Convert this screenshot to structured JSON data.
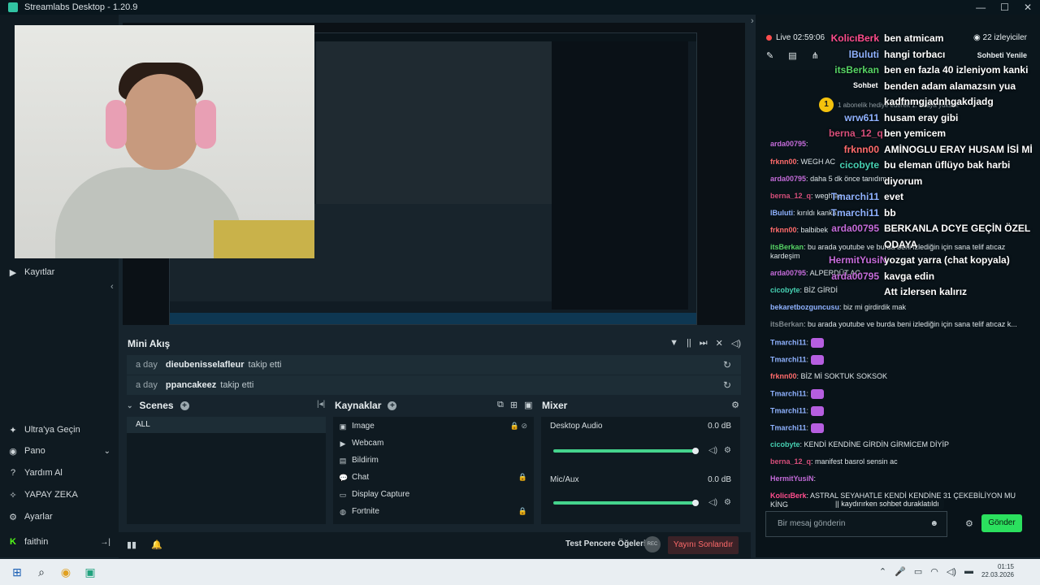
{
  "app": {
    "title": "Streamlabs Desktop - 1.20.9"
  },
  "nav": {
    "items": [
      {
        "id": "kayitlar",
        "label": "Kayıtlar",
        "icon": "play-circle-icon"
      },
      {
        "id": "ultra",
        "label": "Ultra'ya Geçin",
        "icon": "ultra-icon"
      },
      {
        "id": "pano",
        "label": "Pano",
        "icon": "dashboard-icon"
      },
      {
        "id": "yardim",
        "label": "Yardım Al",
        "icon": "help-icon"
      },
      {
        "id": "yapay",
        "label": "YAPAY ZEKA",
        "icon": "ai-spark-icon"
      },
      {
        "id": "ayarlar",
        "label": "Ayarlar",
        "icon": "gear-icon"
      },
      {
        "id": "user",
        "label": "faithin",
        "icon": "kick-icon"
      }
    ]
  },
  "mini_feed": {
    "title": "Mini Akış",
    "rows": [
      {
        "time": "a day",
        "user": "dieubenisselafleur",
        "action": "takip etti"
      },
      {
        "time": "a day",
        "user": "ppancakeez",
        "action": "takip etti"
      }
    ]
  },
  "scenes": {
    "title": "Scenes",
    "items": [
      "ALL"
    ]
  },
  "sources": {
    "title": "Kaynaklar",
    "items": [
      {
        "label": "Image",
        "icon": "image-icon",
        "locked": true
      },
      {
        "label": "Webcam",
        "icon": "camera-icon",
        "locked": false
      },
      {
        "label": "Bildirim",
        "icon": "bell-icon",
        "locked": false
      },
      {
        "label": "Chat",
        "icon": "chat-icon",
        "locked": true
      },
      {
        "label": "Display Capture",
        "icon": "monitor-icon",
        "locked": false
      },
      {
        "label": "Fortnite",
        "icon": "gamepad-icon",
        "locked": true
      }
    ]
  },
  "mixer": {
    "title": "Mixer",
    "channels": [
      {
        "label": "Desktop Audio",
        "db": "0.0 dB",
        "level": 1.0
      },
      {
        "label": "Mic/Aux",
        "db": "0.0 dB",
        "level": 1.0
      }
    ]
  },
  "footer": {
    "test_label": "Test Pencere Öğeleri",
    "rec": "REC",
    "end_label": "Yayını Sonlandır"
  },
  "chat": {
    "live": "Live 02:59:06",
    "viewers": "22 izleyiciler",
    "refresh": "Sohbeti Yenile",
    "tab": "Sohbet",
    "sub_banner": "1 abonelik hediye ederek 1. sıraya yüksel!",
    "sub_badge": "1",
    "messages": [
      {
        "user": "arda00795",
        "color": "#c46bd9",
        "text": "",
        "sticker": false
      },
      {
        "user": "frknn00",
        "color": "#ff6b6b",
        "text": "WEGH AC",
        "sticker": false
      },
      {
        "user": "arda00795",
        "color": "#c46bd9",
        "text": "daha 5 dk önce tanıdım",
        "sticker": false
      },
      {
        "user": "berna_12_q",
        "color": "#d64e7a",
        "text": "wegh ac",
        "sticker": false
      },
      {
        "user": "lBuluti",
        "color": "#8fb2ff",
        "text": "kırıldı kanka",
        "sticker": false
      },
      {
        "user": "frknn00",
        "color": "#ff6b6b",
        "text": "balbibek",
        "sticker": false
      },
      {
        "user": "itsBerkan",
        "color": "#56d364",
        "text": "bu arada youtube ve burda beni izlediğin için sana telif atıcaz kardeşim",
        "sticker": false
      },
      {
        "user": "arda00795",
        "color": "#c46bd9",
        "text": "ALPERDÜT AC",
        "sticker": false
      },
      {
        "user": "cicobyte",
        "color": "#46d0b2",
        "text": "BİZ GİRDİ",
        "sticker": false
      },
      {
        "user": "bekaretbozguncusu",
        "color": "#8fb2ff",
        "text": "biz mi girdirdik mak",
        "sticker": false
      },
      {
        "user": "itsBerkan",
        "color": "#7d878c",
        "text": "bu arada youtube ve burda beni izlediğin için sana telif atıcaz k...",
        "sticker": false
      },
      {
        "user": "Tmarchi11",
        "color": "#8fb2ff",
        "text": "",
        "sticker": true
      },
      {
        "user": "Tmarchi11",
        "color": "#8fb2ff",
        "text": "",
        "sticker": true
      },
      {
        "user": "frknn00",
        "color": "#ff6b6b",
        "text": "BİZ Mİ SOKTUK SOKSOK",
        "sticker": false
      },
      {
        "user": "Tmarchi11",
        "color": "#8fb2ff",
        "text": "",
        "sticker": true
      },
      {
        "user": "Tmarchi11",
        "color": "#8fb2ff",
        "text": "",
        "sticker": true
      },
      {
        "user": "Tmarchi11",
        "color": "#8fb2ff",
        "text": "",
        "sticker": true
      },
      {
        "user": "cicobyte",
        "color": "#46d0b2",
        "text": "KENDİ KENDİNE GİRDİN GİRMİCEM DİYİP",
        "sticker": false
      },
      {
        "user": "berna_12_q",
        "color": "#d64e7a",
        "text": "manifest basrol sensin ac",
        "sticker": false
      },
      {
        "user": "HermitYusiN",
        "color": "#c46bd9",
        "text": "",
        "sticker": false
      },
      {
        "user": "KolicıBerk",
        "color": "#ff4d8d",
        "text": "ASTRAL SEYAHATLE KENDİ KENDİNE 31 ÇEKEBİLİYON MU KİNG",
        "sticker": false
      }
    ],
    "overlay": [
      {
        "user": "KolicıBerk",
        "color": "#ff4d8d",
        "text": "ben atmicam"
      },
      {
        "user": "lBuluti",
        "color": "#8fb2ff",
        "text": "hangi torbacı"
      },
      {
        "user": "itsBerkan",
        "color": "#56d364",
        "text": "ben en fazla 40 izleniyom kanki"
      },
      {
        "user": "",
        "color": "#ffffff",
        "text": "benden adam alamazsın yua"
      },
      {
        "user": "",
        "color": "#ffffff",
        "text": "kadfnmgjadnhgakdjadg"
      },
      {
        "user": "wrw611",
        "color": "#8fb2ff",
        "text": "husam eray gibi"
      },
      {
        "user": "berna_12_q",
        "color": "#d64e7a",
        "text": "ben yemicem"
      },
      {
        "user": "frknn00",
        "color": "#ff6b6b",
        "text": "AMİNOGLU ERAY HUSAM İSİ Mİ"
      },
      {
        "user": "cicobyte",
        "color": "#46d0b2",
        "text": "bu eleman üflüyo bak harbi"
      },
      {
        "user": "",
        "color": "#ffffff",
        "text": "diyorum"
      },
      {
        "user": "Tmarchi11",
        "color": "#8fb2ff",
        "text": "evet"
      },
      {
        "user": "Tmarchi11",
        "color": "#8fb2ff",
        "text": "bb"
      },
      {
        "user": "arda00795",
        "color": "#c46bd9",
        "text": "BERKANLA DCYE GEÇİN ÖZEL"
      },
      {
        "user": "",
        "color": "#ffffff",
        "text": "ODAYA"
      },
      {
        "user": "HermitYusiN",
        "color": "#c46bd9",
        "text": "yozgat yarra (chat kopyala)"
      },
      {
        "user": "arda00795",
        "color": "#c46bd9",
        "text": "kavga edin"
      },
      {
        "user": "",
        "color": "#ffffff",
        "text": "Att izlersen kalırız"
      }
    ],
    "paused": "kaydırırken sohbet duraklatıldı",
    "input_placeholder": "Bir mesaj gönderin",
    "send_label": "Gönder"
  },
  "taskbar": {
    "time": "01:15",
    "date": "22.03.2026"
  }
}
